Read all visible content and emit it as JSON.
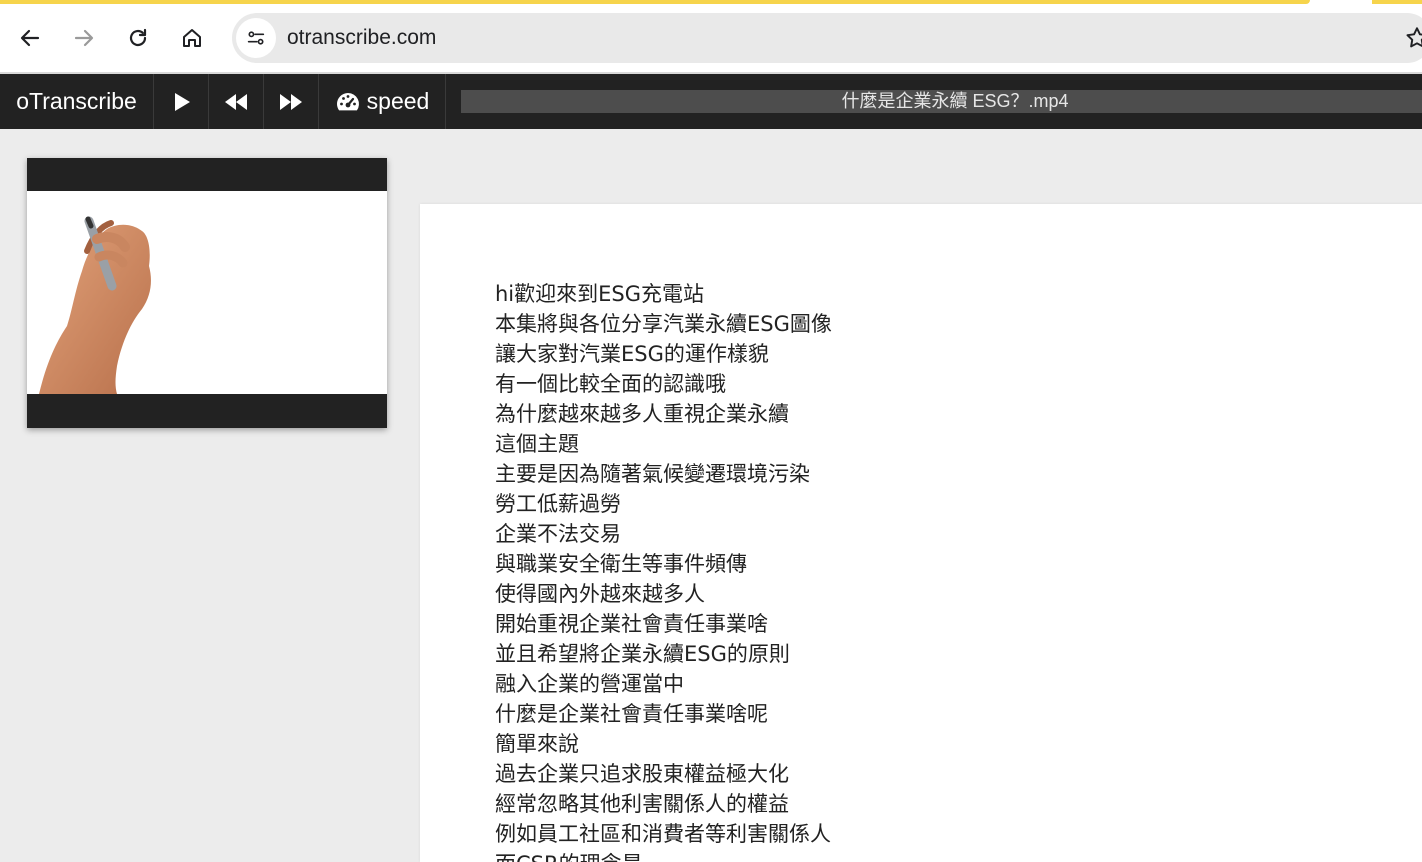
{
  "browser": {
    "url": "otranscribe.com",
    "back_icon": "arrow-left-icon",
    "forward_icon": "arrow-right-icon",
    "reload_icon": "reload-icon",
    "home_icon": "home-icon",
    "site_info_icon": "tune-icon",
    "bookmark_icon": "star-icon",
    "accent_color": "#f6d44c"
  },
  "toolbar": {
    "brand": "oTranscribe",
    "play_icon": "play-icon",
    "rewind_icon": "rewind-icon",
    "fast_forward_icon": "fast-forward-icon",
    "speed_icon": "speedometer-icon",
    "speed_label": "speed",
    "file_name": "什麼是企業永續 ESG？.mp4"
  },
  "editor": {
    "lines": [
      "hi歡迎來到ESG充電站",
      "本集將與各位分享汽業永續ESG圖像",
      "讓大家對汽業ESG的運作樣貌",
      "有一個比較全面的認識哦",
      "為什麼越來越多人重視企業永續",
      "這個主題",
      "主要是因為隨著氣候變遷環境污染",
      "勞工低薪過勞",
      "企業不法交易",
      "與職業安全衛生等事件頻傳",
      "使得國內外越來越多人",
      "開始重視企業社會責任事業啥",
      "並且希望將企業永續ESG的原則",
      "融入企業的營運當中",
      "什麼是企業社會責任事業啥呢",
      "簡單來說",
      "過去企業只追求股東權益極大化",
      "經常忽略其他利害關係人的權益",
      "例如員工社區和消費者等利害關係人",
      "而CSR的理念是"
    ]
  }
}
